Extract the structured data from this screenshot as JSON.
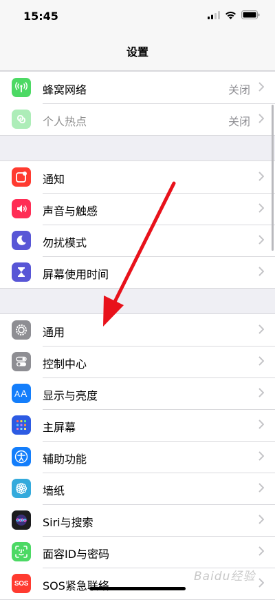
{
  "status_bar": {
    "time": "15:45"
  },
  "nav": {
    "title": "设置"
  },
  "groups": [
    [
      {
        "label": "蜂窝网络",
        "value": "关闭",
        "icon": "antenna-icon",
        "color": "#4cd964"
      },
      {
        "label": "个人热点",
        "value": "关闭",
        "icon": "hotspot-icon",
        "color": "#4cd964",
        "dimmed": true
      }
    ],
    [
      {
        "label": "通知",
        "icon": "notifications-icon",
        "color": "#ff3b30"
      },
      {
        "label": "声音与触感",
        "icon": "speaker-icon",
        "color": "#ff2d55"
      },
      {
        "label": "勿扰模式",
        "icon": "moon-icon",
        "color": "#5856d6"
      },
      {
        "label": "屏幕使用时间",
        "icon": "hourglass-icon",
        "color": "#5856d6"
      }
    ],
    [
      {
        "label": "通用",
        "icon": "gear-icon",
        "color": "#8e8e93"
      },
      {
        "label": "控制中心",
        "icon": "toggles-icon",
        "color": "#8e8e93"
      },
      {
        "label": "显示与亮度",
        "icon": "aa-text-icon",
        "color": "#147efb"
      },
      {
        "label": "主屏幕",
        "icon": "home-grid-icon",
        "color": "#2d5be3"
      },
      {
        "label": "辅助功能",
        "icon": "accessibility-icon",
        "color": "#147efb"
      },
      {
        "label": "墙纸",
        "icon": "flower-icon",
        "color": "#34aadc"
      },
      {
        "label": "Siri与搜索",
        "icon": "siri-icon",
        "color": "#1c1c1e"
      },
      {
        "label": "面容ID与密码",
        "icon": "face-id-icon",
        "color": "#4cd964"
      },
      {
        "label": "SOS紧急联络",
        "icon": "sos-icon",
        "color": "#ff3b30",
        "glyph": "SOS"
      }
    ]
  ],
  "annotation": {
    "color": "#e8121b"
  },
  "watermark": {
    "text": "Baidu经验"
  }
}
